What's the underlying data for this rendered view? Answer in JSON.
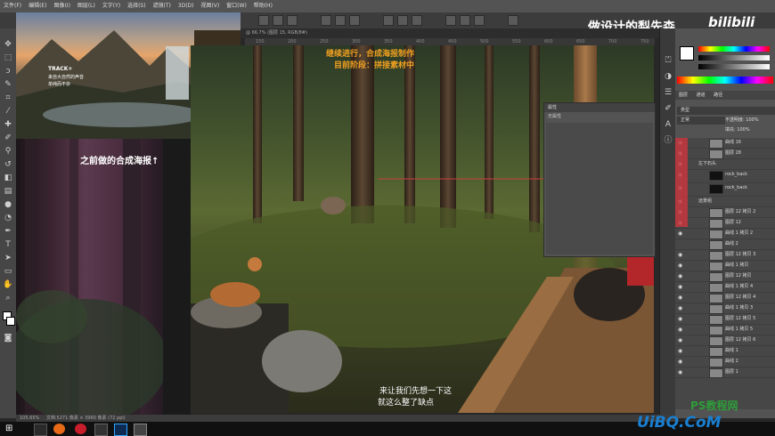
{
  "menu": {
    "items": [
      "文件(F)",
      "编辑(E)",
      "图像(I)",
      "图层(L)",
      "文字(Y)",
      "选择(S)",
      "滤镜(T)",
      "3D(D)",
      "视图(V)",
      "窗口(W)",
      "帮助(H)"
    ]
  },
  "document_tab": {
    "title": "@ 66.7% (图层 15, RGB/8#)"
  },
  "ruler_ticks": [
    "150",
    "200",
    "250",
    "300",
    "350",
    "400",
    "450",
    "500",
    "550",
    "600",
    "650",
    "700",
    "750"
  ],
  "watermark": {
    "title": "做设计的梨先森",
    "brand": "bilibili"
  },
  "poster_top": {
    "title": "TRACK+",
    "line1": "来自大自然的声音",
    "line2": "单纯而不杂"
  },
  "poster_caption": "之前做的合成海报↑",
  "canvas_notes": {
    "line1": "继续进行，合成海报制作",
    "line2": "目前阶段：拼接素材中"
  },
  "subtitle": {
    "line1": "来让我们先想一下这",
    "line2": "就这么整了缺点"
  },
  "properties_panel": {
    "header": "属性",
    "subheader": "无属性"
  },
  "layers_panel": {
    "tabs": [
      "图层",
      "通道",
      "路径"
    ],
    "kind_filter": "类型",
    "blend_mode": "正常",
    "opacity_label": "不透明度: 100%",
    "fill_label": "填充: 100%",
    "layers": [
      {
        "name": "曲线 16",
        "visible": true
      },
      {
        "name": "图层 28",
        "visible": true
      },
      {
        "name": "左下石头",
        "visible": true
      },
      {
        "name": "rock_back",
        "visible": true
      },
      {
        "name": "rock_back",
        "visible": true
      },
      {
        "name": "远景组",
        "visible": true
      },
      {
        "name": "图层 12 拷贝 2",
        "visible": true
      },
      {
        "name": "图层 12",
        "visible": true
      },
      {
        "name": "曲线 1 拷贝 2",
        "visible": true
      },
      {
        "name": "曲线 2",
        "visible": false
      },
      {
        "name": "图层 12 拷贝 3",
        "visible": true
      },
      {
        "name": "曲线 1 拷贝",
        "visible": true
      },
      {
        "name": "图层 12 拷贝",
        "visible": true
      },
      {
        "name": "曲线 1 拷贝 4",
        "visible": true
      },
      {
        "name": "图层 12 拷贝 4",
        "visible": true
      },
      {
        "name": "曲线 1 拷贝 3",
        "visible": true
      },
      {
        "name": "图层 12 拷贝 5",
        "visible": true
      },
      {
        "name": "曲线 1 拷贝 5",
        "visible": true
      },
      {
        "name": "图层 12 拷贝 6",
        "visible": true
      },
      {
        "name": "曲线 1",
        "visible": true
      },
      {
        "name": "曲线 2",
        "visible": true
      },
      {
        "name": "图层 1",
        "visible": true
      }
    ]
  },
  "status": {
    "zoom": "105.65%",
    "doc": "文档:5271 像素 × 3960 像素 (72 ppi)"
  },
  "site_logo": {
    "text": "UiBQ.CoM",
    "subtitle": "PS教程网"
  },
  "colors": {
    "ps_bg": "#282828",
    "panel": "#535353",
    "accent_red": "#c6373f",
    "canvas_text": "#f0a020"
  }
}
